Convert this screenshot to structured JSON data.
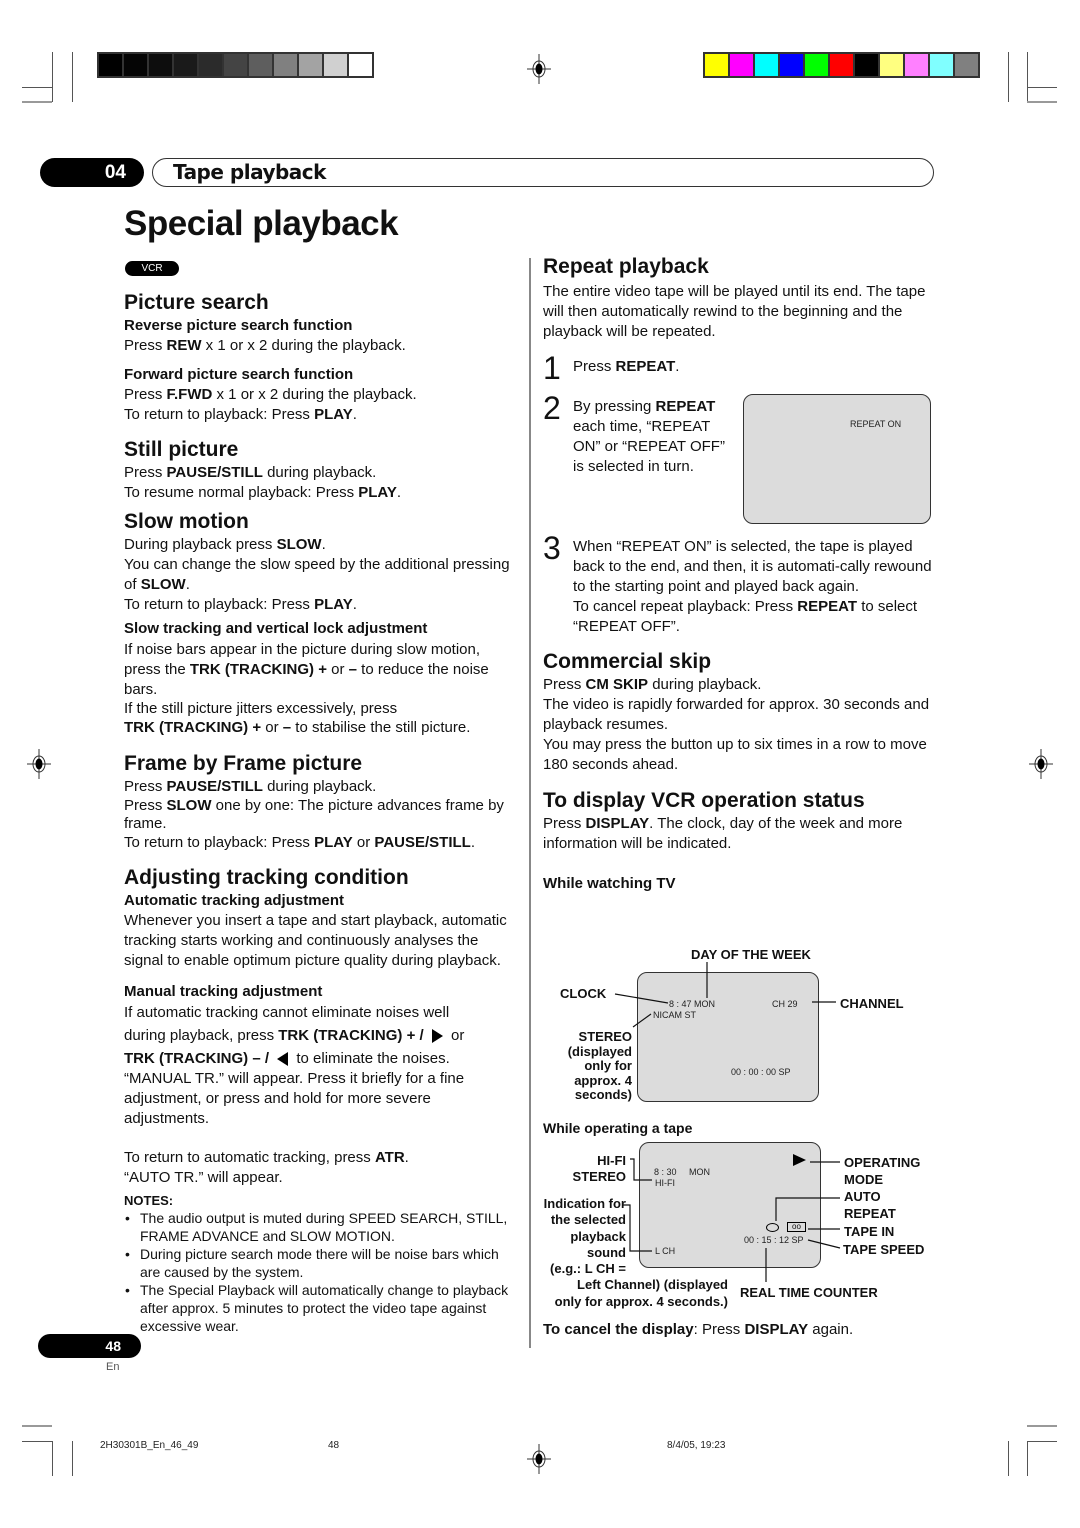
{
  "print_marks": {
    "grayscale_swatches": [
      "#000000",
      "#050505",
      "#0d0d0d",
      "#1a1a1a",
      "#2b2b2b",
      "#444444",
      "#5e5e5e",
      "#808080",
      "#a3a3a3",
      "#d0d0d0",
      "#ffffff"
    ],
    "color_swatches": [
      "#ffff00",
      "#ff00ff",
      "#00ffff",
      "#0000ff",
      "#00ff00",
      "#ff0000",
      "#000000",
      "#ffff80",
      "#ff80ff",
      "#80ffff",
      "#808080"
    ]
  },
  "header": {
    "chapter_number": "04",
    "chapter_title": "Tape playback"
  },
  "page_title": "Special playback",
  "badge": "VCR",
  "left": {
    "picture_search": {
      "title": "Picture search",
      "reverse_title": "Reverse picture search function",
      "reverse_text": [
        "Press ",
        "REW",
        " x 1 or x 2 during the playback."
      ],
      "forward_title": "Forward picture search function",
      "forward_text": [
        "Press ",
        "F.FWD",
        " x 1 or x 2 during the playback."
      ],
      "return_text": [
        "To return to playback: Press ",
        "PLAY",
        "."
      ]
    },
    "still_picture": {
      "title": "Still picture",
      "line1": [
        "Press ",
        "PAUSE/STILL",
        " during playback."
      ],
      "line2": [
        "To resume normal playback: Press ",
        "PLAY",
        "."
      ]
    },
    "slow_motion": {
      "title": "Slow motion",
      "line1": [
        "During playback press ",
        "SLOW",
        "."
      ],
      "line2": [
        "You can change the slow speed by the additional pressing of ",
        "SLOW",
        "."
      ],
      "line3": [
        "To return to playback: Press ",
        "PLAY",
        "."
      ],
      "sub_title": "Slow tracking and vertical lock adjustment",
      "sub_line1": [
        "If noise bars appear in the picture during slow motion, press the ",
        "TRK (TRACKING) +",
        " or ",
        "–",
        " to reduce the noise bars."
      ],
      "sub_line2": "If the still picture jitters excessively, press",
      "sub_line3": [
        "TRK (TRACKING) +",
        " or ",
        "–",
        " to stabilise the still picture."
      ]
    },
    "frame_by_frame": {
      "title": "Frame by Frame picture",
      "line1": [
        "Press ",
        "PAUSE/STILL",
        " during playback."
      ],
      "line2": [
        "Press ",
        "SLOW",
        " one by one: The picture advances frame by frame."
      ],
      "line3": [
        "To return to playback: Press ",
        "PLAY",
        " or ",
        "PAUSE/STILL",
        "."
      ]
    },
    "tracking": {
      "title": "Adjusting tracking condition",
      "auto_title": "Automatic tracking adjustment",
      "auto_text": "Whenever you insert a tape and start playback, automatic tracking starts working and continuously analyses the signal to enable optimum picture quality during playback.",
      "manual_title": "Manual tracking adjustment",
      "manual_line1": "If automatic tracking cannot eliminate noises well",
      "manual_line2a": "during playback, press ",
      "manual_line2b": "TRK (TRACKING) + /",
      "manual_line2c": " or",
      "manual_line3a": "TRK (TRACKING) – /",
      "manual_line3b": " to eliminate the noises.",
      "manual_line4": "“MANUAL TR.” will appear. Press it briefly for a fine adjustment, or press and hold for more severe adjustments.",
      "atr_line1": [
        "To return to automatic tracking, press ",
        "ATR",
        "."
      ],
      "atr_line2": "“AUTO TR.” will appear."
    },
    "notes": {
      "title": "NOTES:",
      "items": [
        "The audio output is muted during SPEED SEARCH, STILL, FRAME ADVANCE and SLOW MOTION.",
        "During picture search mode there will be noise bars which are caused by the system.",
        "The Special Playback will automatically change to playback after approx. 5 minutes to protect the video tape against excessive wear."
      ]
    }
  },
  "right": {
    "repeat": {
      "title": "Repeat playback",
      "intro": "The entire video tape will be played until its end. The tape will then automatically rewind to the beginning and the playback will be repeated.",
      "step1_num": "1",
      "step1": [
        "Press ",
        "REPEAT",
        "."
      ],
      "step2_num": "2",
      "step2": [
        "By pressing ",
        "REPEAT",
        " each time, “REPEAT ON” or “REPEAT OFF” is selected in turn."
      ],
      "screen_text": "REPEAT ON",
      "step3_num": "3",
      "step3": "When “REPEAT ON” is selected, the tape is played back to the end, and then, it is automati-cally rewound to the starting point and played back again.",
      "step3_cancel": [
        "To cancel repeat playback: Press ",
        "REPEAT",
        " to select “REPEAT OFF”."
      ]
    },
    "commercial_skip": {
      "title": "Commercial skip",
      "line1": [
        "Press ",
        "CM SKIP",
        " during playback."
      ],
      "line2": "The video is rapidly forwarded for approx. 30 seconds and playback resumes.",
      "line3": "You may press the button up to six times in a row to move 180 seconds ahead."
    },
    "status": {
      "title": "To display VCR operation status",
      "intro": [
        "Press ",
        "DISPLAY",
        ". The clock, day of the week and more information will be indicated."
      ],
      "tv_title": "While watching TV",
      "tv_labels": {
        "day": "DAY OF THE WEEK",
        "clock": "CLOCK",
        "channel": "CHANNEL",
        "stereo": [
          "STEREO",
          "(displayed",
          "only for",
          "approx. 4",
          "seconds)"
        ]
      },
      "tv_osd": {
        "time_day": "8 : 47  MON",
        "nicam": "NICAM ST",
        "channel": "CH  29",
        "counter": "00 : 00 : 00  SP"
      },
      "tape_title": "While operating a tape",
      "tape_labels": {
        "hifi": [
          "HI-FI",
          "STEREO"
        ],
        "indication": [
          "Indication for",
          "the selected",
          "playback",
          "sound",
          "(e.g.: L CH =",
          "Left Channel) (displayed",
          "only for approx. 4 seconds.)"
        ],
        "operating": [
          "OPERATING",
          "MODE"
        ],
        "auto_repeat": [
          "AUTO",
          "REPEAT"
        ],
        "tape_in": "TAPE IN",
        "tape_speed": "TAPE SPEED",
        "counter": "REAL TIME COUNTER"
      },
      "tape_osd": {
        "time": "8 : 30",
        "day": "MON",
        "hifi": "HI-FI",
        "lch": "L CH",
        "counter": "00 : 15 : 12  SP"
      },
      "cancel": [
        "To cancel the display",
        ":  Press ",
        "DISPLAY",
        " again."
      ]
    }
  },
  "footer": {
    "page_number": "48",
    "language": "En",
    "file_name": "2H30301B_En_46_49",
    "file_page": "48",
    "timestamp": "8/4/05, 19:23"
  }
}
